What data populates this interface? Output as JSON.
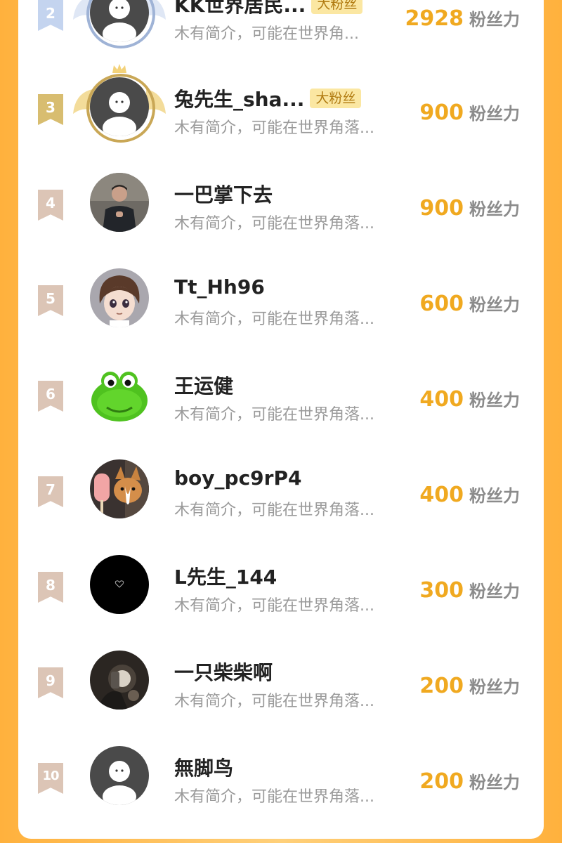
{
  "colors": {
    "background": "#ffb13d",
    "count_accent": "#f0a920",
    "badge_bg": "#fbe7a2",
    "badge_text": "#b07a10",
    "rank_bronze": "#dcc5b6",
    "rank_gold": "#d8bd70",
    "rank_silver": "#c4d4ef"
  },
  "fans": [
    {
      "rank": "2",
      "name": "KK世界居民...",
      "badge": "大粉丝",
      "bio": "木有简介，可能在世界角...",
      "count": "2928",
      "unit": "粉丝力",
      "avatar": "default-avatar-icon",
      "frame": "silver"
    },
    {
      "rank": "3",
      "name": "兔先生_sha...",
      "badge": "大粉丝",
      "bio": "木有简介，可能在世界角落...",
      "count": "900",
      "unit": "粉丝力",
      "avatar": "default-avatar-icon",
      "frame": "gold"
    },
    {
      "rank": "4",
      "name": "一巴掌下去",
      "bio": "木有简介，可能在世界角落...",
      "count": "900",
      "unit": "粉丝力",
      "avatar": "person-photo"
    },
    {
      "rank": "5",
      "name": "Tt_Hh96",
      "bio": "木有简介，可能在世界角落...",
      "count": "600",
      "unit": "粉丝力",
      "avatar": "anime-boy-avatar"
    },
    {
      "rank": "6",
      "name": "王运健",
      "bio": "木有简介，可能在世界角落...",
      "count": "400",
      "unit": "粉丝力",
      "avatar": "green-frog-avatar"
    },
    {
      "rank": "7",
      "name": "boy_pc9rP4",
      "bio": "木有简介，可能在世界角落...",
      "count": "400",
      "unit": "粉丝力",
      "avatar": "corgi-popsicle-avatar"
    },
    {
      "rank": "8",
      "name": "L先生_144",
      "bio": "木有简介，可能在世界角落...",
      "count": "300",
      "unit": "粉丝力",
      "avatar": "black-heart-avatar"
    },
    {
      "rank": "9",
      "name": "一只柴柴啊",
      "bio": "木有简介，可能在世界角落...",
      "count": "200",
      "unit": "粉丝力",
      "avatar": "dark-photo-avatar"
    },
    {
      "rank": "10",
      "name": "無脚鸟",
      "bio": "木有简介，可能在世界角落...",
      "count": "200",
      "unit": "粉丝力",
      "avatar": "default-avatar-icon"
    }
  ]
}
